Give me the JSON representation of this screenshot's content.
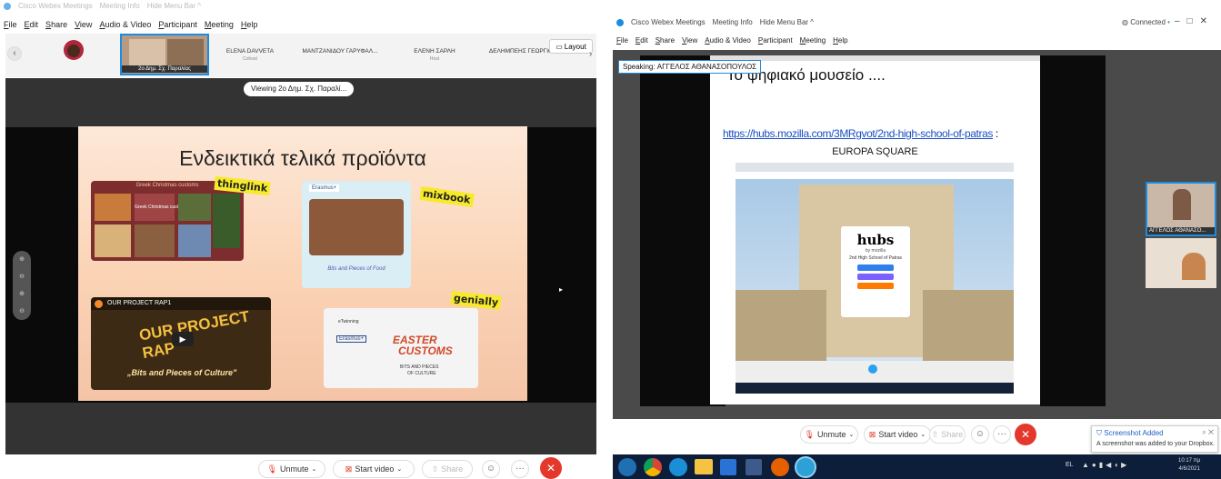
{
  "left": {
    "titlebar": {
      "app": "Cisco Webex Meetings",
      "info": "Meeting Info",
      "hide": "Hide Menu Bar ^"
    },
    "menu": [
      "File",
      "Edit",
      "Share",
      "View",
      "Audio & Video",
      "Participant",
      "Meeting",
      "Help"
    ],
    "participants": [
      {
        "name": "ELENA DAVVETA",
        "sub": "Cohost"
      },
      {
        "name": "ΜΑΝΤΖΑΝΙΔΟΥ ΓΑΡΥΦΑΛ...",
        "sub": ""
      },
      {
        "name": "ΕΛΕΝΗ ΣΑΡΛΗ",
        "sub": "Host"
      },
      {
        "name": "ΔΕΛΗΜΠΕΗΣ ΓΕΩΡΓΙΟΣ",
        "sub": ""
      }
    ],
    "active_tile": "2ο Δημ. Σχ. Παραλίας",
    "layout_label": "Layout",
    "viewing_label": "Viewing 2ο Δημ. Σχ. Παραλί...",
    "slide": {
      "title": "Ενδεικτικά τελικά προϊόντα",
      "tags": [
        "thinglink",
        "mixbook",
        "genially"
      ],
      "greek_customs": "Greek Christmas customs",
      "greek_customs_inner": "Greek Christmas customs",
      "erasmus": "Erasmus+",
      "bits_food": "Bits and Pieces of Food",
      "video_title": "OUR PROJECT RAP1",
      "video_overlay": "OUR PROJECT RAP",
      "video_caption": "„Bits and Pieces of Culture\"",
      "easter_line1": "EASTER",
      "easter_line2": "CUSTOMS",
      "etwinning": "eTwinning",
      "erasmus2": "Erasmus+",
      "bits_culture1": "BITS AND PIECES",
      "bits_culture2": "OF CULTURE"
    },
    "controls": {
      "unmute": "Unmute",
      "start_video": "Start video",
      "share": "Share"
    }
  },
  "right": {
    "titlebar": {
      "app": "Cisco Webex Meetings",
      "info": "Meeting Info",
      "hide": "Hide Menu Bar ^",
      "status": "Connected"
    },
    "menu": [
      "File",
      "Edit",
      "Share",
      "View",
      "Audio & Video",
      "Participant",
      "Meeting",
      "Help"
    ],
    "speaking_label": "Speaking: ΑΓΓΕΛΟΣ ΑΘΑΝΑΣΟΠΟΥΛΟΣ",
    "slide": {
      "title": "Το ψηφιακό μουσείο ....",
      "link": "https://hubs.mozilla.com/3MRgvot/2nd-high-school-of-patras",
      "link_suffix": ":",
      "subtitle": "EUROPA SQUARE",
      "hubs_logo": "hubs",
      "hubs_by": "by mozilla",
      "hubs_room": "2nd High School of Patras"
    },
    "self_tile": "ΑΓΓΕΛΟΣ ΑΘΑΝΑΣΟ...",
    "controls": {
      "unmute": "Unmute",
      "start_video": "Start video",
      "share": "Share"
    },
    "toast": {
      "title": "Screenshot Added",
      "body": "A screenshot was added to your Dropbox."
    },
    "tray": {
      "time": "10:17 πμ",
      "date": "4/6/2021",
      "lang": "EL"
    }
  },
  "colors": {
    "red": "#e5382d",
    "webex_blue": "#1d8ce0",
    "slide_bg_top": "#fde3d0",
    "slide_bg_bottom": "#f7c8a8",
    "tag_yellow": "#f6ea2a",
    "taskbar": "#0c1e3a"
  }
}
